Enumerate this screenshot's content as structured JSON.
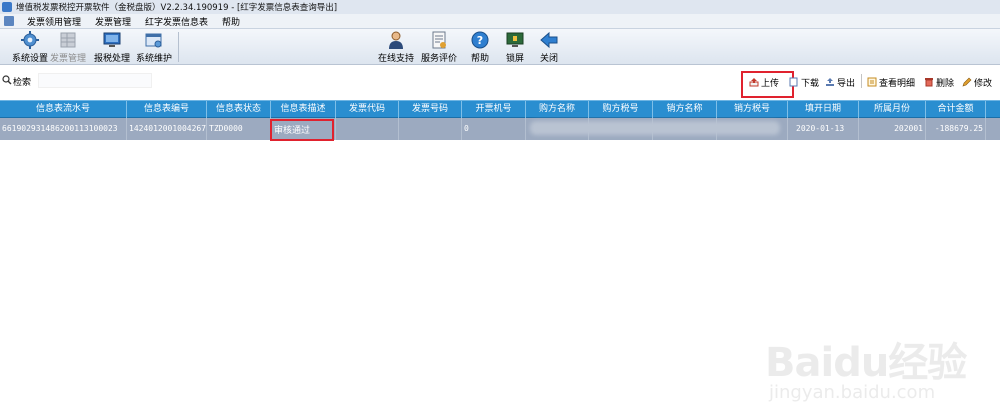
{
  "window": {
    "title": "增值税发票税控开票软件（金税盘版）V2.2.34.190919 - [红字发票信息表查询导出]"
  },
  "menu": [
    "发票领用管理",
    "发票管理",
    "红字发票信息表",
    "帮助"
  ],
  "toolbar": {
    "system_settings": "系统设置",
    "invoice_mgmt": "发票管理",
    "tax_report": "报税处理",
    "system_maintenance": "系统维护",
    "online_support": "在线支持",
    "service_rating": "服务评价",
    "help": "帮助",
    "lock_screen": "锁屏",
    "close": "关闭"
  },
  "search": {
    "label": "检索",
    "value": ""
  },
  "actions": {
    "upload": "上传",
    "download": "下载",
    "export": "导出",
    "view_detail": "查看明细",
    "delete": "删除",
    "modify": "修改"
  },
  "table": {
    "columns": [
      "信息表流水号",
      "信息表编号",
      "信息表状态",
      "信息表描述",
      "发票代码",
      "发票号码",
      "开票机号",
      "购方名称",
      "购方税号",
      "销方名称",
      "销方税号",
      "填开日期",
      "所属月份",
      "合计金额"
    ],
    "rows": [
      {
        "serial": "661902931486200113100023",
        "number": "1424012001004267",
        "status": "TZD0000",
        "description": "审核通过",
        "invoice_code": "",
        "invoice_number": "",
        "machine_no": "0",
        "buyer_name": "",
        "buyer_tax_id": "",
        "seller_name": "",
        "seller_tax_id": "",
        "date": "2020-01-13",
        "month": "202001",
        "total": "-188679.25"
      }
    ]
  },
  "watermark": {
    "logo": "Baidu经验",
    "url": "jingyan.baidu.com"
  },
  "colors": {
    "header_bg": "#2a8ed0",
    "row_selected_bg": "#9caac0",
    "highlight_border": "#e0222e",
    "toolbar_bg": "#dde5ef"
  }
}
